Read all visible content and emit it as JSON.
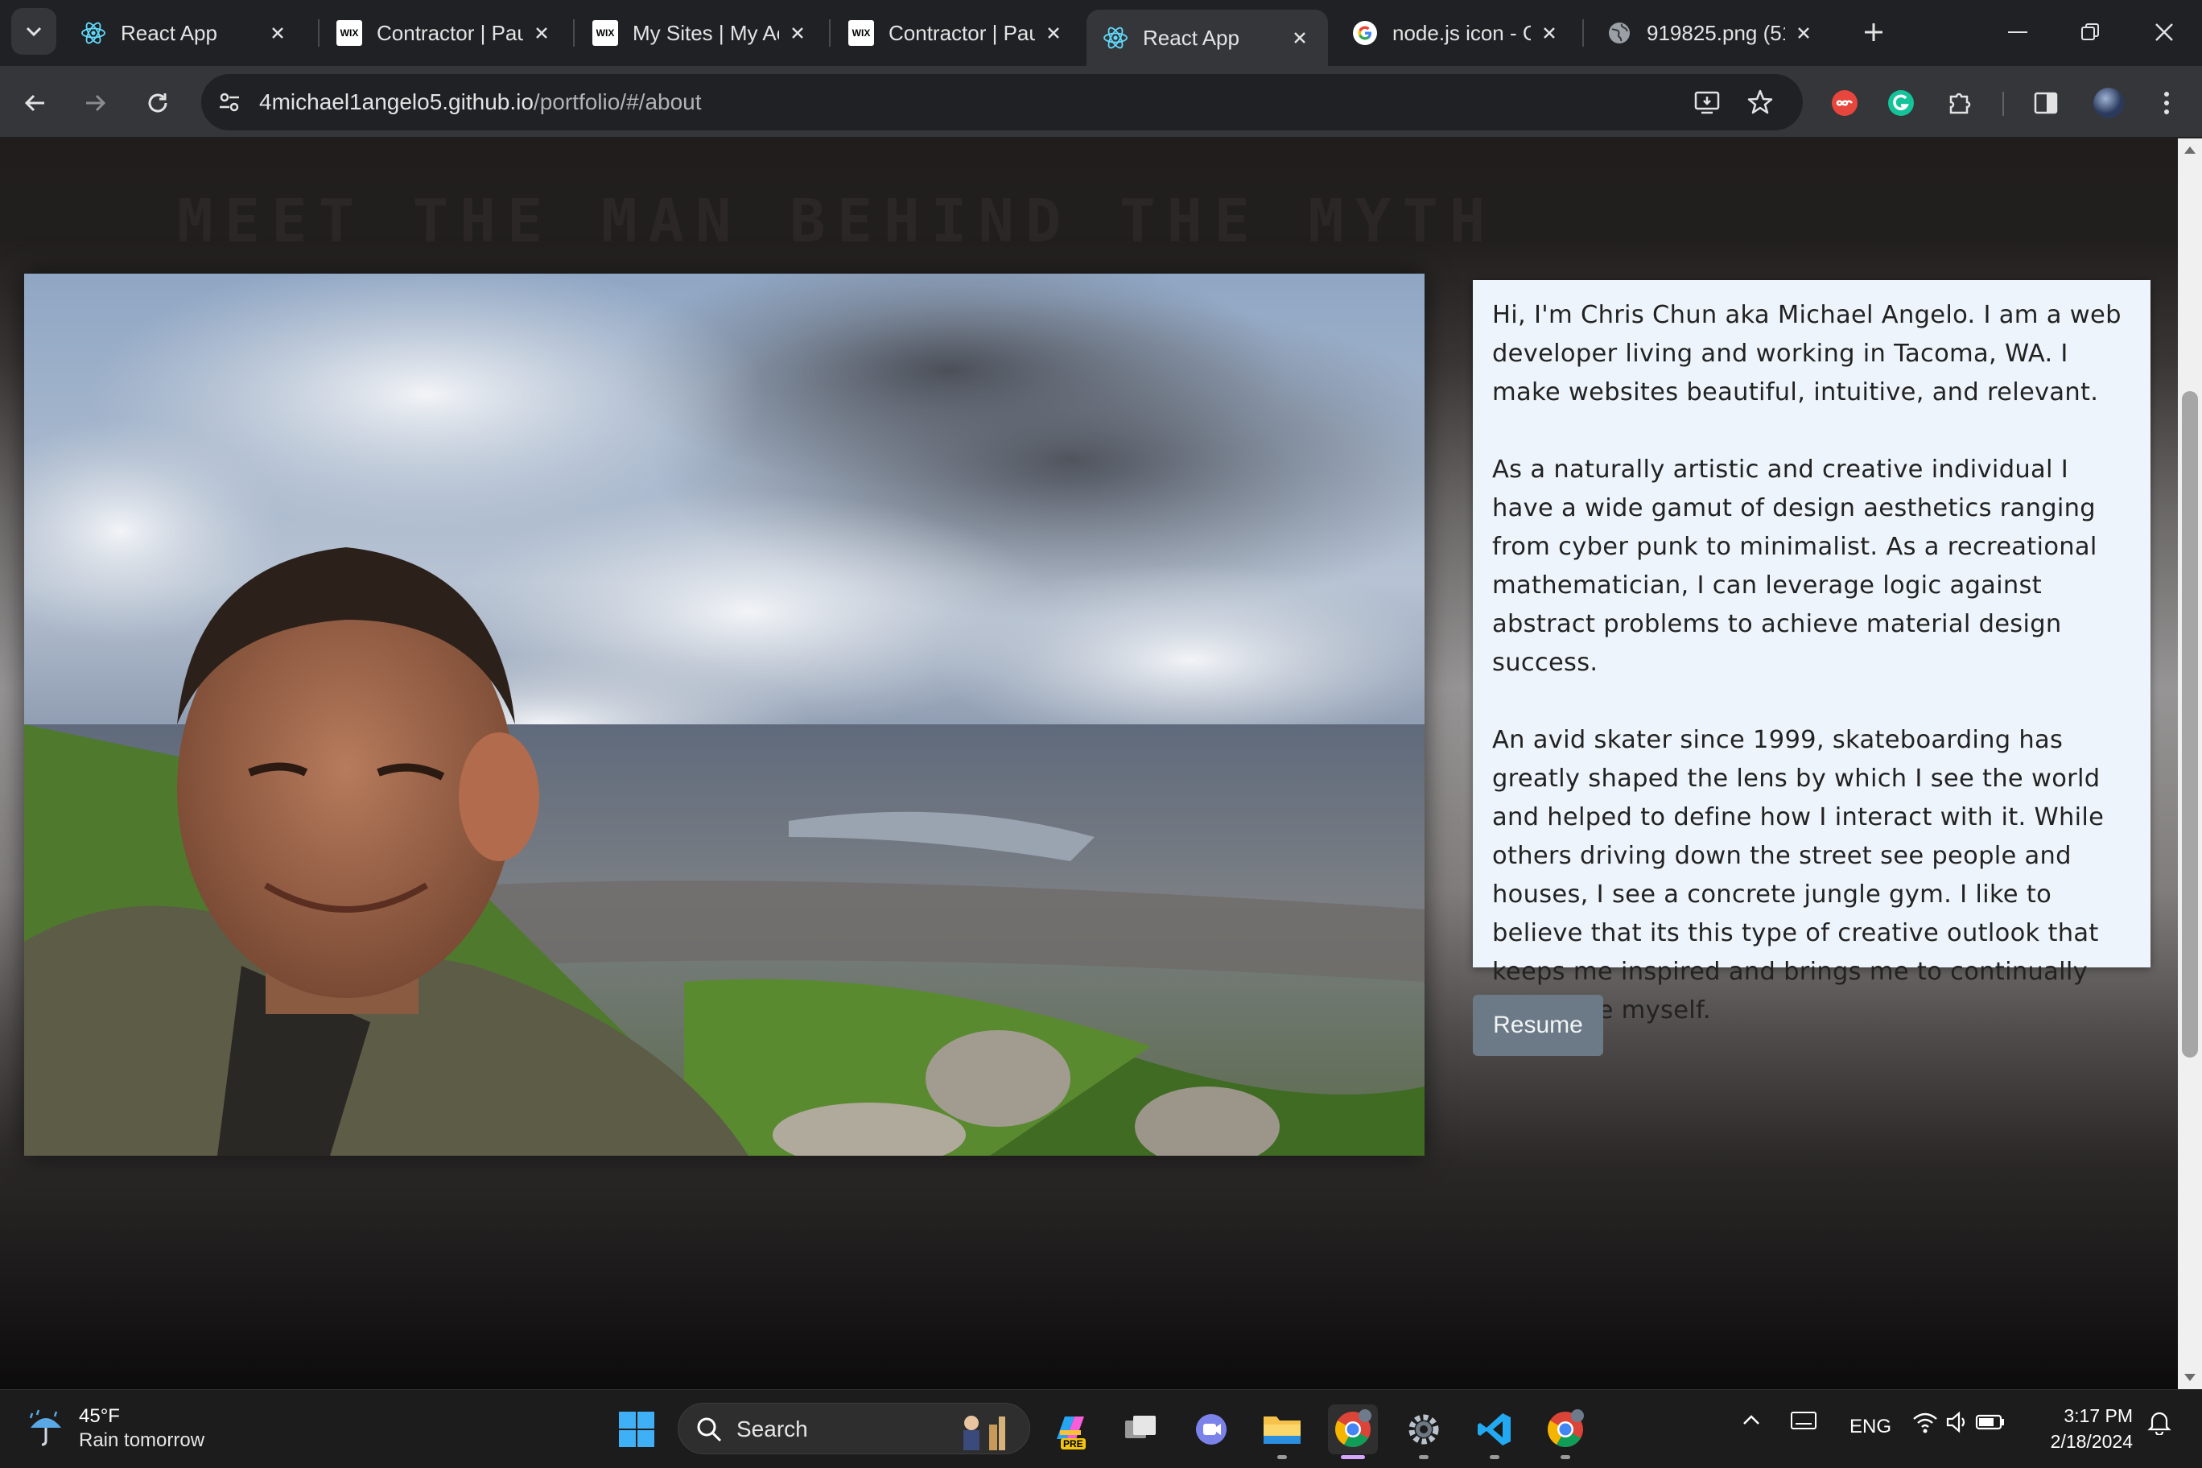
{
  "browser": {
    "tabs": [
      {
        "title": "React App",
        "favicon": "react-icon",
        "active": false
      },
      {
        "title": "Contractor | Paul",
        "favicon": "wix-icon",
        "active": false
      },
      {
        "title": "My Sites | My Ac",
        "favicon": "wix-icon",
        "active": false
      },
      {
        "title": "Contractor | Paul",
        "favicon": "wix-icon",
        "active": false
      },
      {
        "title": "React App",
        "favicon": "react-icon",
        "active": true
      },
      {
        "title": "node.js icon - Go",
        "favicon": "google-icon",
        "active": false
      },
      {
        "title": "919825.png (512",
        "favicon": "globe-icon",
        "active": false
      }
    ],
    "wix_label": "WIX",
    "url_host": "4michael1angelo5.github.io",
    "url_path": "/portfolio/#/about"
  },
  "page": {
    "heading": "MEET THE MAN BEHIND THE MYTH",
    "paragraphs": [
      "Hi, I'm Chris Chun aka Michael Angelo. I am a web developer living and working in Tacoma, WA. I make websites beautiful, intuitive, and relevant.",
      "As a naturally artistic and creative individual I have a wide gamut of design aesthetics ranging from cyber punk to minimalist. As a recreational mathematician, I can leverage logic against abstract problems to achieve material design success.",
      "An avid skater since 1999, skateboarding has greatly shaped the lens by which I see the world and helped to define how I interact with it. While others driving down the street see people and houses, I see a concrete jungle gym. I like to believe that its this type of creative outlook that keeps me inspired and brings me to continually challenge myself."
    ],
    "resume_label": "Resume",
    "card_color": "#eef4fb",
    "button_color": "#6b7a86"
  },
  "taskbar": {
    "weather_temp": "45°F",
    "weather_desc": "Rain tomorrow",
    "search_label": "Search",
    "copilot_badge": "PRE",
    "language": "ENG",
    "time": "3:17 PM",
    "date": "2/18/2024"
  }
}
